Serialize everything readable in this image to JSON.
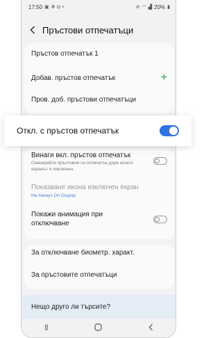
{
  "status": {
    "time": "17:50",
    "battery": "20%",
    "left_icons": [
      "photo-icon",
      "settings-icon",
      "camera-icon",
      "dot-icon"
    ],
    "right_icons": [
      "mute-icon",
      "wifi-icon",
      "signal-icon",
      "battery-icon"
    ]
  },
  "header": {
    "title": "Пръстови отпечатъци"
  },
  "fingerprints": {
    "item1": "Пръстов отпечатък 1",
    "add": "Добав. пръстов отпечатък",
    "check": "Пров. доб. пръстови отпечатъци"
  },
  "spotlight": {
    "label": "Откл. с пръстов отпечатък",
    "toggle_on": true
  },
  "options": {
    "always_on_label": "Винаги вкл. пръстов отпечатък",
    "always_on_sub": "Сканирайте пръстовия си отпечатък дори когато екранът е изключен.",
    "show_icon_label": "Показване икона изключен екран",
    "show_icon_sub": "На Always On Display",
    "animation_label": "Покажи анимация при отключване"
  },
  "info": {
    "biometric": "За отключване биометр. характ.",
    "about": "За пръстовите отпечатъци"
  },
  "search_hint": "Нещо друго ли търсите?",
  "colors": {
    "accent": "#2f73e0",
    "plus": "#2e9d4d",
    "link": "#4a7fd1"
  }
}
